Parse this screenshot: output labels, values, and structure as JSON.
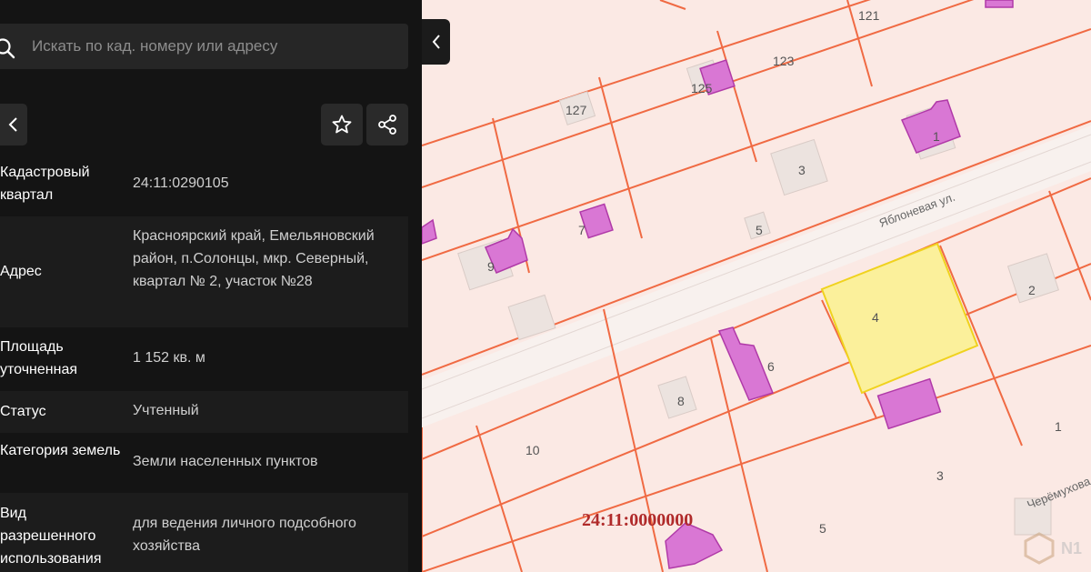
{
  "search": {
    "placeholder": "Искать по кад. номеру или адресу"
  },
  "info": {
    "rows": [
      {
        "label": "Кадастровый квартал",
        "value": "24:11:0290105"
      },
      {
        "label": "Адрес",
        "value": "Красноярский край, Емельяновский район, п.Солонцы, мкр. Северный, квартал № 2, участок №28"
      },
      {
        "label": "Площадь уточненная",
        "value": "1 152 кв. м"
      },
      {
        "label": "Статус",
        "value": "Учтенный"
      },
      {
        "label": "Категория земель",
        "value": "Земли населенных пунктов"
      },
      {
        "label": "Вид разрешенного использования",
        "value": "для ведения личного подсобного хозяйства"
      }
    ]
  },
  "map": {
    "plot_numbers": [
      "121",
      "123",
      "125",
      "127",
      "1",
      "3",
      "5",
      "7",
      "9",
      "4",
      "2",
      "6",
      "8",
      "10",
      "1",
      "3",
      "5"
    ],
    "street_1": "Яблоневая ул.",
    "street_2": "Черёмухова",
    "quarter_label": "24:11:0000000",
    "colors": {
      "selected_plot": "#fbf09b",
      "building": "#d977d4",
      "boundary": "#f06a43"
    }
  },
  "watermark": {
    "text": "N1"
  },
  "icons": [
    "search-icon",
    "chevron-left-icon",
    "star-icon",
    "share-icon",
    "chevron-left-icon"
  ]
}
